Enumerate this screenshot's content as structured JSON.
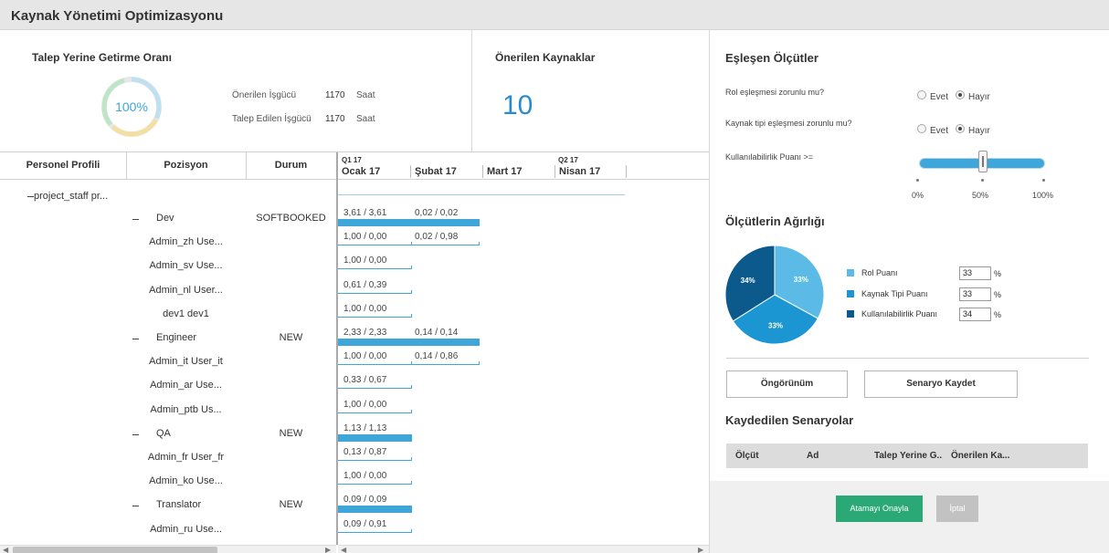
{
  "app": {
    "title": "Kaynak Yönetimi Optimizasyonu"
  },
  "summary": {
    "fulfillment_title": "Talep Yerine Getirme Oranı",
    "fulfillment_pct": "100%",
    "fulfillment_ratio": 1.0,
    "rows": [
      {
        "label": "Önerilen İşgücü",
        "value": "1170",
        "unit": "Saat"
      },
      {
        "label": "Talep Edilen İşgücü",
        "value": "1170",
        "unit": "Saat"
      }
    ],
    "recommended_title": "Önerilen Kaynaklar",
    "recommended_count": "10"
  },
  "grid": {
    "headers": {
      "profile": "Personel Profili",
      "position": "Pozisyon",
      "status": "Durum"
    },
    "timeline": {
      "quarters": [
        "Q1 17",
        "Q2 17"
      ],
      "months": [
        "Ocak 17",
        "Şubat 17",
        "Mart 17",
        "Nisan 17"
      ]
    },
    "root_label": "project_staff pr...",
    "rows": [
      {
        "name": "Dev",
        "status": "SOFTBOOKED",
        "type": "group",
        "v1": "3,61 / 3,61",
        "v2": "0,02 / 0,02"
      },
      {
        "name": "Admin_zh Use...",
        "type": "person",
        "v1": "1,00 / 0,00",
        "v2": "0,02 / 0,98"
      },
      {
        "name": "Admin_sv Use...",
        "type": "person",
        "v1": "1,00 / 0,00"
      },
      {
        "name": "Admin_nl User...",
        "type": "person",
        "v1": "0,61 / 0,39"
      },
      {
        "name": "dev1 dev1",
        "type": "person",
        "v1": "1,00 / 0,00"
      },
      {
        "name": "Engineer",
        "status": "NEW",
        "type": "group",
        "v1": "2,33 / 2,33",
        "v2": "0,14 / 0,14"
      },
      {
        "name": "Admin_it User_it",
        "type": "person",
        "v1": "1,00 / 0,00",
        "v2": "0,14 / 0,86"
      },
      {
        "name": "Admin_ar Use...",
        "type": "person",
        "v1": "0,33 / 0,67"
      },
      {
        "name": "Admin_ptb Us...",
        "type": "person",
        "v1": "1,00 / 0,00"
      },
      {
        "name": "QA",
        "status": "NEW",
        "type": "group",
        "v1": "1,13 / 1,13"
      },
      {
        "name": "Admin_fr User_fr",
        "type": "person",
        "v1": "0,13 / 0,87"
      },
      {
        "name": "Admin_ko Use...",
        "type": "person",
        "v1": "1,00 / 0,00"
      },
      {
        "name": "Translator",
        "status": "NEW",
        "type": "group",
        "v1": "0,09 / 0,09"
      },
      {
        "name": "Admin_ru Use...",
        "type": "person",
        "v1": "0,09 / 0,91"
      }
    ]
  },
  "criteria": {
    "title": "Eşleşen Ölçütler",
    "q1": "Rol eşleşmesi zorunlu mu?",
    "q2": "Kaynak tipi eşleşmesi zorunlu mu?",
    "yes": "Evet",
    "no": "Hayır",
    "q1_selected": "Hayır",
    "q2_selected": "Hayır",
    "availability_label": "Kullanılabilirlik Puanı  >=",
    "slider_value_pct": 50,
    "slider_ticks": [
      "0%",
      "50%",
      "100%"
    ]
  },
  "weights": {
    "title": "Ölçütlerin Ağırlığı",
    "items": [
      {
        "label": "Rol Puanı",
        "value": "33",
        "color": "#5bbbe6"
      },
      {
        "label": "Kaynak Tipi Puanı",
        "value": "33",
        "color": "#1b96d2"
      },
      {
        "label": "Kullanılabilirlik Puanı",
        "value": "34",
        "color": "#0c5a8c"
      }
    ],
    "pie_labels": [
      "33%",
      "33%",
      "34%"
    ],
    "percent_sign": "%"
  },
  "actions": {
    "preview": "Öngörünüm",
    "save": "Senaryo Kaydet"
  },
  "saved": {
    "title": "Kaydedilen Senaryolar",
    "columns": [
      "Ölçüt",
      "Ad",
      "Talep Yerine G..",
      "Önerilen Ka..."
    ]
  },
  "footer": {
    "confirm": "Atamayı Onayla",
    "cancel": "İptal"
  }
}
